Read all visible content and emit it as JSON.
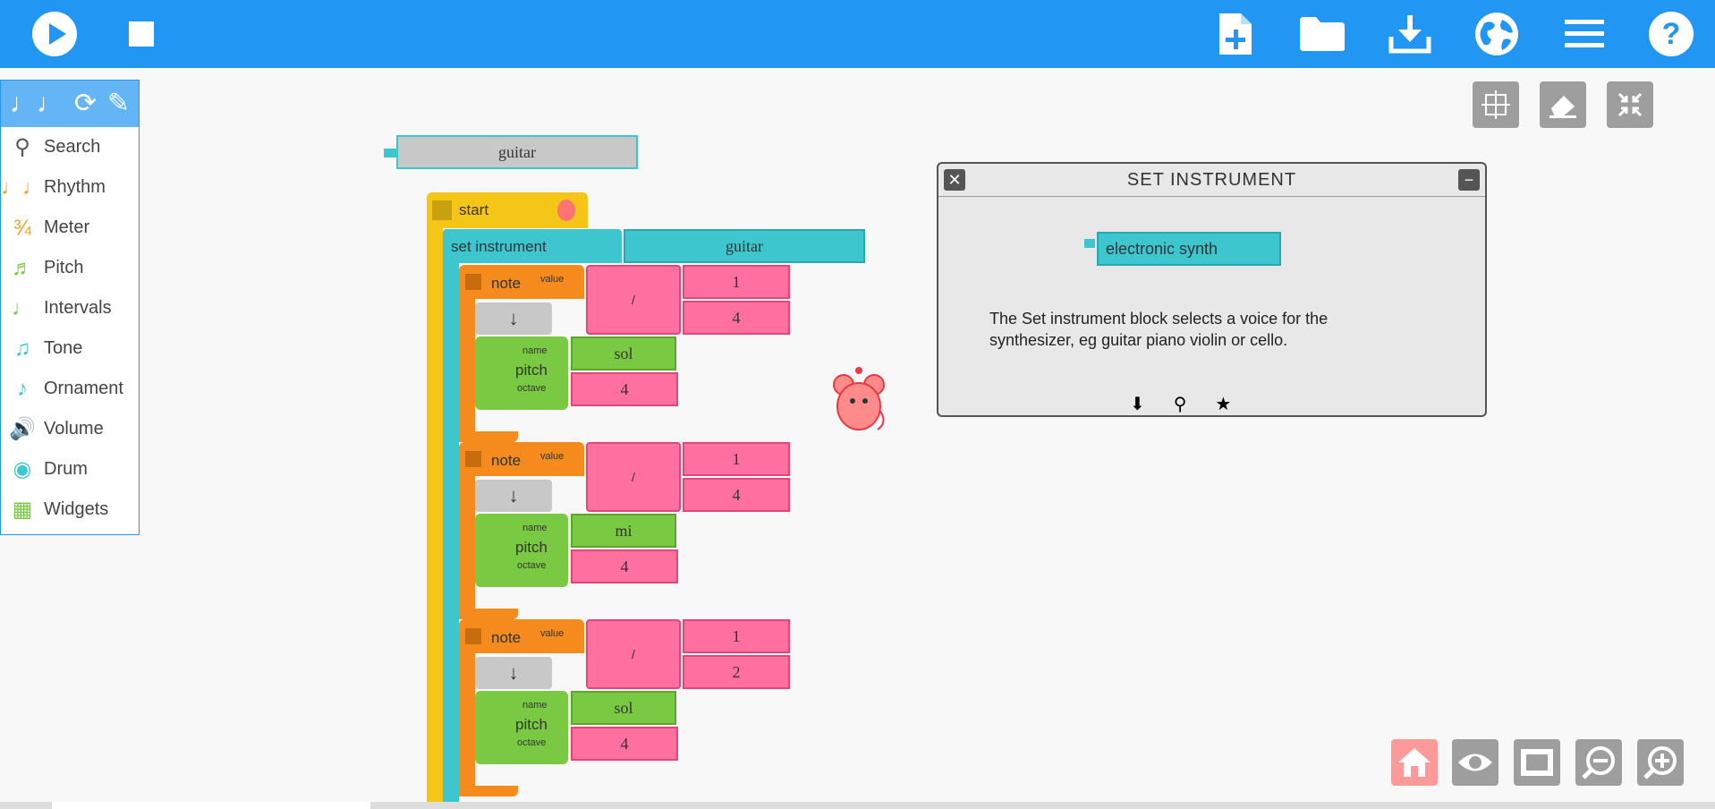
{
  "toolbar": {
    "left": [
      {
        "name": "play-icon"
      },
      {
        "name": "stop-icon"
      }
    ],
    "right": [
      {
        "name": "new-file-icon"
      },
      {
        "name": "open-folder-icon"
      },
      {
        "name": "save-download-icon"
      },
      {
        "name": "language-globe-icon"
      },
      {
        "name": "menu-icon"
      },
      {
        "name": "help-icon"
      }
    ],
    "color": "#2196f3"
  },
  "palette": {
    "header_icons": [
      "notes-icon",
      "refresh-icon",
      "pen-icon"
    ],
    "items": [
      {
        "label": "Search",
        "icon": "search-icon",
        "color": "#555555"
      },
      {
        "label": "Rhythm",
        "icon": "notes-icon",
        "color": "#f2a021"
      },
      {
        "label": "Meter",
        "icon": "meter-icon",
        "color": "#f2a021"
      },
      {
        "label": "Pitch",
        "icon": "pitch-icon",
        "color": "#7ac943"
      },
      {
        "label": "Intervals",
        "icon": "intervals-icon",
        "color": "#7ac943"
      },
      {
        "label": "Tone",
        "icon": "tone-icon",
        "color": "#3ec6cf"
      },
      {
        "label": "Ornament",
        "icon": "ornament-icon",
        "color": "#3ec6cf"
      },
      {
        "label": "Volume",
        "icon": "volume-icon",
        "color": "#3ec6cf"
      },
      {
        "label": "Drum",
        "icon": "drum-icon",
        "color": "#3ec6cf"
      },
      {
        "label": "Widgets",
        "icon": "widgets-icon",
        "color": "#7ac943"
      }
    ]
  },
  "canvas_tools": [
    "grid-icon",
    "eraser-icon",
    "collapse-icon"
  ],
  "blocks": {
    "loose_guitar": "guitar",
    "start": "start",
    "set_instrument": "set instrument",
    "set_instrument_value": "guitar",
    "divide": "/",
    "note_label": "note",
    "value_label": "value",
    "pitch_label": "pitch",
    "name_label": "name",
    "octave_label": "octave",
    "down_arrow": "↓",
    "notes": [
      {
        "num": "1",
        "den": "4",
        "pitch": "sol",
        "octave": "4"
      },
      {
        "num": "1",
        "den": "4",
        "pitch": "mi",
        "octave": "4"
      },
      {
        "num": "1",
        "den": "2",
        "pitch": "sol",
        "octave": "4"
      }
    ]
  },
  "help": {
    "title": "SET INSTRUMENT",
    "example_block": "electronic synth",
    "text_line1": "The Set instrument block selects a voice for the",
    "text_line2": "synthesizer, eg guitar piano violin or cello.",
    "icons": [
      "download-icon",
      "search-icon",
      "star-icon"
    ]
  },
  "bottom_tools": [
    "home-icon",
    "hide-blocks-eye-icon",
    "collapse-blocks-icon",
    "zoom-out-icon",
    "zoom-in-icon"
  ]
}
